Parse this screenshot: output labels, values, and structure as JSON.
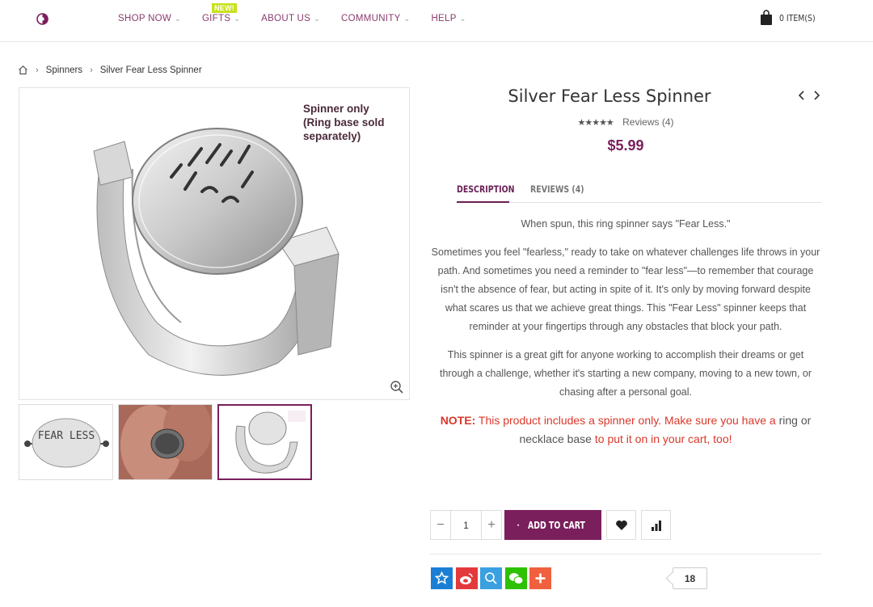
{
  "header": {
    "nav": [
      {
        "label": "SHOP NOW"
      },
      {
        "label": "GIFTS",
        "badge": "NEW!"
      },
      {
        "label": "ABOUT US"
      },
      {
        "label": "COMMUNITY"
      },
      {
        "label": "HELP"
      }
    ],
    "cart_label": "0 ITEM(S)"
  },
  "breadcrumb": [
    "Spinners",
    "Silver Fear Less Spinner"
  ],
  "gallery": {
    "caption_line1": "Spinner only",
    "caption_line2": "(Ring base sold",
    "caption_line3": "separately)",
    "spinner_text": "FEAR LESS"
  },
  "product": {
    "title": "Silver Fear Less Spinner",
    "reviews_label": "Reviews (4)",
    "stars": "★★★★★",
    "price": "$5.99"
  },
  "tabs": [
    {
      "label": "DESCRIPTION",
      "active": true
    },
    {
      "label": "REVIEWS (4)",
      "active": false
    }
  ],
  "description": {
    "p1": "When spun, this ring spinner says \"Fear Less.\"",
    "p2": "Sometimes you feel \"fearless,\" ready to take on whatever challenges life throws in your path. And sometimes you need a reminder to \"fear less\"—to remember that courage isn't the absence of fear, but acting in spite of it. It's only by moving forward despite what scares us that we achieve great things. This \"Fear Less\" spinner keeps that reminder at your fingertips through any obstacles that block your path.",
    "p3": "This spinner is a great gift for anyone working to accomplish their dreams or get through a challenge, whether it's starting a new company, moving to a new town, or chasing after a personal goal.",
    "note_label": "NOTE:",
    "note_part1": "This product includes a spinner only. Make sure you have a",
    "note_link1": "ring",
    "note_part2": "or",
    "note_link2": "necklace base",
    "note_part3": "to put it on in your cart, too!"
  },
  "purchase": {
    "quantity": "1",
    "minus": "−",
    "plus": "+",
    "add_to_cart": "ADD TO CART"
  },
  "share": {
    "count": "18"
  },
  "colors": {
    "brand": "#7a1f5c",
    "note": "#d9382b",
    "badge": "#c8e11e"
  }
}
